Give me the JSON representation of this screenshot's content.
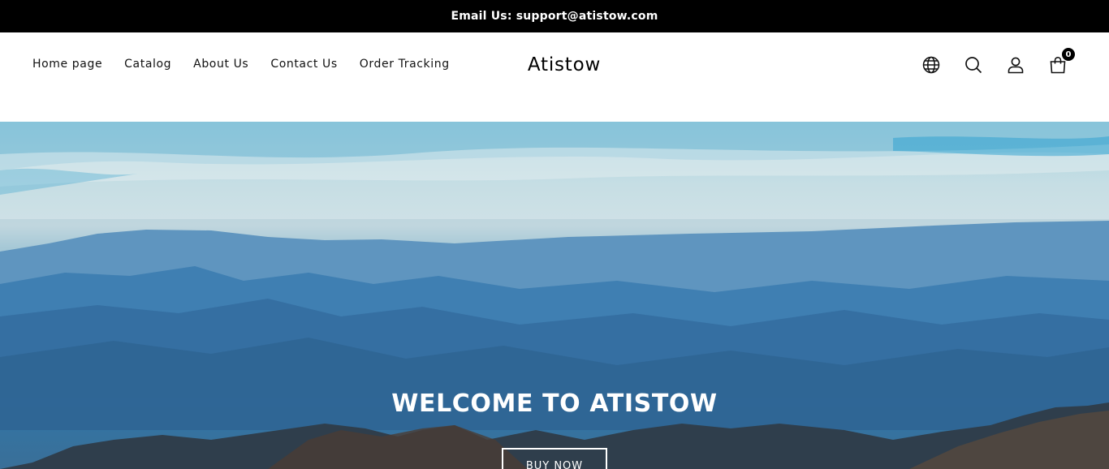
{
  "announcement": {
    "text": "Email Us: support@atistow.com"
  },
  "nav": {
    "items": [
      {
        "label": "Home page"
      },
      {
        "label": "Catalog"
      },
      {
        "label": "About Us"
      },
      {
        "label": "Contact Us"
      },
      {
        "label": "Order Tracking"
      }
    ]
  },
  "logo": {
    "text": "Atistow"
  },
  "header_icons": {
    "language": "globe-icon",
    "search": "search-icon",
    "account": "user-icon",
    "cart": "bag-icon",
    "cart_count": "0"
  },
  "hero": {
    "title": "WELCOME TO ATISTOW",
    "button_label": "BUY NOW"
  },
  "colors": {
    "announcement_bg": "#000000",
    "announcement_text": "#ffffff",
    "header_bg": "#ffffff",
    "hero_text": "#ffffff"
  }
}
